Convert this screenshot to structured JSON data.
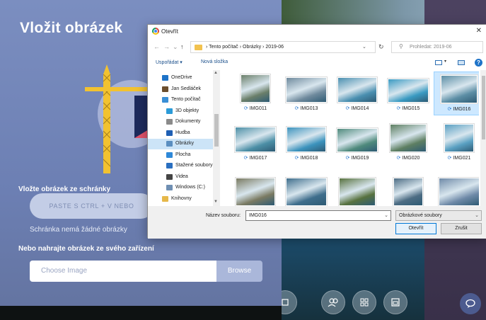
{
  "app": {
    "panel_title": "Vložit obrázek",
    "clipboard_title": "Vložte obrázek ze schránky",
    "paste_button": "PASTE S CTRL + V NEBO",
    "clipboard_empty": "Schránka nemá žádné obrázky",
    "upload_title": "Nebo nahrajte obrázek ze svého zařízení",
    "file_placeholder": "Choose Image",
    "browse_button": "Browse"
  },
  "dialog": {
    "title": "Otevřít",
    "close": "✕",
    "nav": {
      "back": "←",
      "forward": "→",
      "recent": "⌄",
      "up": "↑"
    },
    "breadcrumb": [
      "Tento počítač",
      "Obrázky",
      "2019-06"
    ],
    "path_dropdown": "⌄",
    "refresh": "↻",
    "search_placeholder": "Prohledat: 2019-06",
    "organize": "Uspořádat ▾",
    "new_folder": "Nová složka",
    "help": "?",
    "sidebar": [
      {
        "label": "OneDrive",
        "icon": "cloud-icon",
        "color": "#1e73c8"
      },
      {
        "label": "Jan Sedláček",
        "icon": "user-icon",
        "color": "#6b4e2e"
      },
      {
        "label": "Tento počítač",
        "icon": "computer-icon",
        "color": "#3a8fd6"
      },
      {
        "label": "3D objekty",
        "icon": "cube-icon",
        "color": "#2b9bd8"
      },
      {
        "label": "Dokumenty",
        "icon": "document-icon",
        "color": "#8a8a8a"
      },
      {
        "label": "Hudba",
        "icon": "music-icon",
        "color": "#1e5fb4"
      },
      {
        "label": "Obrázky",
        "icon": "pictures-icon",
        "color": "#5a8ec0",
        "selected": true
      },
      {
        "label": "Plocha",
        "icon": "desktop-icon",
        "color": "#2e88d8"
      },
      {
        "label": "Stažené soubory",
        "icon": "download-icon",
        "color": "#2a6fc0"
      },
      {
        "label": "Videa",
        "icon": "video-icon",
        "color": "#444444"
      },
      {
        "label": "Windows (C:)",
        "icon": "drive-icon",
        "color": "#6f8fb3"
      },
      {
        "label": "Knihovny",
        "icon": "library-icon",
        "color": "#e6b84a"
      }
    ],
    "files": [
      {
        "name": "IMG011",
        "color": "#6b7f6a"
      },
      {
        "name": "IMG013",
        "color": "#6f8a9d"
      },
      {
        "name": "IMG014",
        "color": "#4a8fb0"
      },
      {
        "name": "IMG015",
        "color": "#3a9ac2"
      },
      {
        "name": "IMG016",
        "color": "#5c8ea5",
        "selected": true
      },
      {
        "name": "IMG017",
        "color": "#4c8fa6"
      },
      {
        "name": "IMG018",
        "color": "#3c93bd"
      },
      {
        "name": "IMG019",
        "color": "#4f8a7c"
      },
      {
        "name": "IMG020",
        "color": "#5e7f62"
      },
      {
        "name": "IMG021",
        "color": "#5aa0c2"
      },
      {
        "name": "",
        "color": "#7a7a62"
      },
      {
        "name": "",
        "color": "#3f6e8c"
      },
      {
        "name": "",
        "color": "#58723f"
      },
      {
        "name": "",
        "color": "#4d6d84"
      },
      {
        "name": "",
        "color": "#6f8aa8"
      }
    ],
    "sync_glyph": "⟳",
    "filename_label": "Název souboru:",
    "filename_value": "IMG016",
    "filename_dropdown": "⌄",
    "filetype": "Obrázkové soubory",
    "filetype_dropdown": "⌄",
    "open_button": "Otevřít",
    "cancel_button": "Zrušit"
  }
}
